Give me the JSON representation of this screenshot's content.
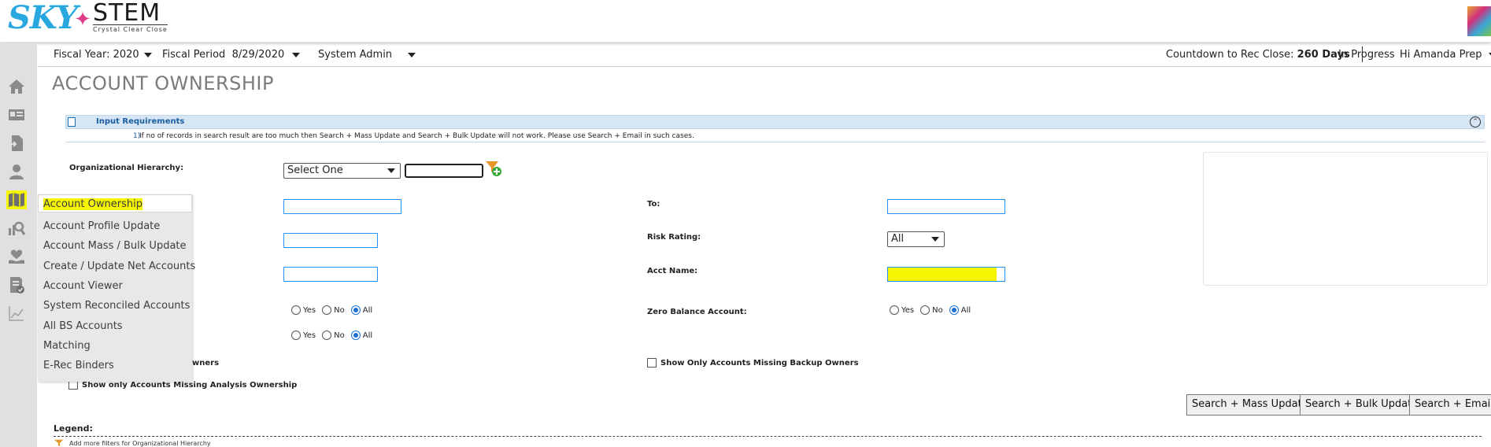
{
  "header": {
    "logo_sky": "SKY",
    "logo_star": "✦",
    "logo_stem": "STEM",
    "logo_tagline": "Crystal Clear Close"
  },
  "infobar": {
    "fiscal_year": "Fiscal Year: 2020",
    "fiscal_period_label": "Fiscal Period",
    "fiscal_period_value": "8/29/2020",
    "role": "System Admin",
    "countdown_label": "Countdown to Rec Close:",
    "countdown_value": "260 Days",
    "status": "In Progress",
    "greeting": "Hi Amanda Prep"
  },
  "page": {
    "title": "ACCOUNT OWNERSHIP"
  },
  "input_requirements": {
    "title": "Input Requirements",
    "collapse_icon": "double-chevron-up",
    "note_number": "1)",
    "note_text": "If no of records in search result are too much then Search + Mass Update and Search + Bulk Update will not work. Please use Search + Email in such cases."
  },
  "form": {
    "org_hierarchy_label": "Organizational Hierarchy:",
    "org_hierarchy_select": "Select One",
    "to_label": "To:",
    "risk_rating_label": "Risk Rating:",
    "risk_rating_value": "All",
    "acct_name_label": "Acct Name:",
    "zero_balance_label": "Zero Balance Account:",
    "radio_yes": "Yes",
    "radio_no": "No",
    "radio_all": "All",
    "missing_owners_label": "wners",
    "missing_backup_label": "Show Only Accounts Missing Backup Owners",
    "missing_analysis_label": "Show only Accounts Missing Analysis Ownership"
  },
  "buttons": {
    "mass_update": "Search + Mass Update",
    "bulk_update": "Search + Bulk Update",
    "email": "Search + Email"
  },
  "legend": {
    "title": "Legend:",
    "item": "Add more filters for Organizational Hierarchy"
  },
  "dropdown_menu": {
    "items": [
      "Account Ownership",
      "Account Profile Update",
      "Account Mass / Bulk Update",
      "Create / Update Net Accounts",
      "Account Viewer",
      "System Reconciled Accounts",
      "All BS Accounts",
      "Matching",
      "E-Rec Binders"
    ]
  },
  "sidebar": {
    "icons": [
      "home-icon",
      "id-card-icon",
      "file-import-icon",
      "user-icon",
      "map-icon",
      "search-chart-icon",
      "hand-heart-icon",
      "report-check-icon",
      "line-chart-icon"
    ]
  },
  "colors": {
    "highlight": "#f5f500",
    "brand_blue": "#29a8e0",
    "brand_pink": "#e23b8a",
    "input_border": "#1e90ff",
    "sidebar_bg": "#e0e0e0"
  }
}
